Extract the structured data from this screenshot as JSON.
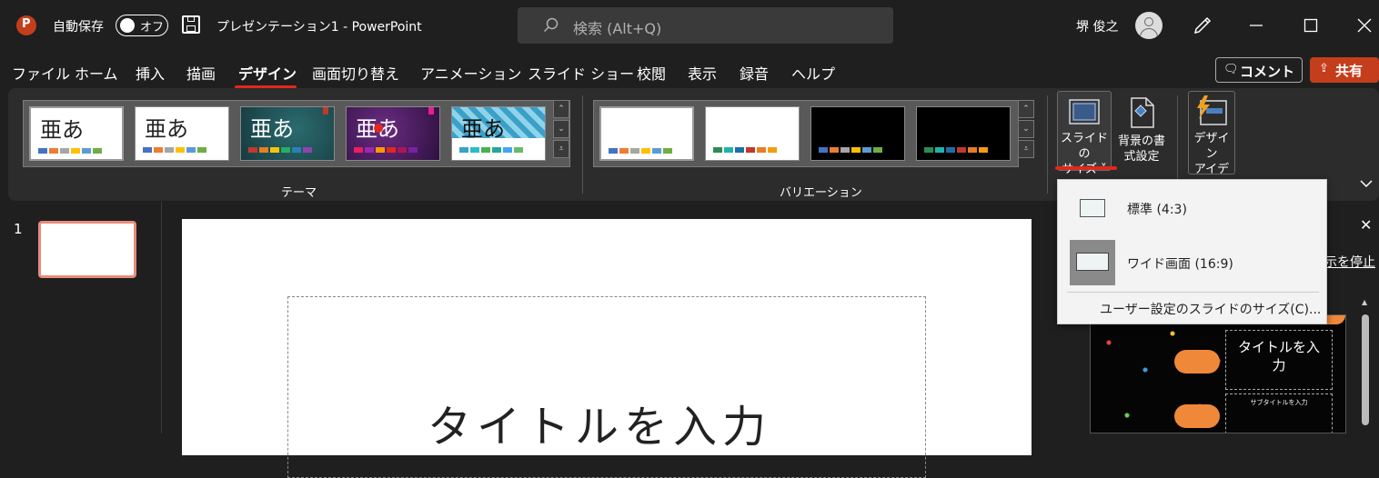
{
  "titlebar": {
    "autosave_label": "自動保存",
    "toggle_label": "オフ",
    "doc_title": "プレゼンテーション1  -  PowerPoint",
    "search_placeholder": "検索 (Alt+Q)",
    "user_name": "堺 俊之"
  },
  "menubar": {
    "tabs": [
      "ファイル",
      "ホーム",
      "挿入",
      "描画",
      "デザイン",
      "画面切り替え",
      "アニメーション",
      "スライド ショー",
      "校閲",
      "表示",
      "録音",
      "ヘルプ"
    ],
    "comment_label": "コメント",
    "share_label": "共有"
  },
  "ribbon": {
    "themes_label": "テーマ",
    "variations_label": "バリエーション",
    "theme_sample_text": "亜あ",
    "slide_size_label_1": "スライドの",
    "slide_size_label_2": "サイズ ˅",
    "bg_format_label_1": "背景の書",
    "bg_format_label_2": "式設定",
    "design_ideas_label_1": "デザイン",
    "design_ideas_label_2": "アイデア"
  },
  "dropdown": {
    "standard": "標準 (4:3)",
    "wide": "ワイド画面 (16:9)",
    "custom": "ユーザー設定のスライドのサイズ(C)..."
  },
  "slides_panel": {
    "slide_number": "1"
  },
  "slide": {
    "title_placeholder": "タイトルを入力"
  },
  "design_pane": {
    "stop_link": "示を停止",
    "preview_title": "タイトルを入",
    "preview_title_2": "力",
    "preview_subtitle": "サブタイトルを入力"
  },
  "colors": {
    "accent_red": "#e0281c",
    "share_orange": "#c43e1c"
  }
}
